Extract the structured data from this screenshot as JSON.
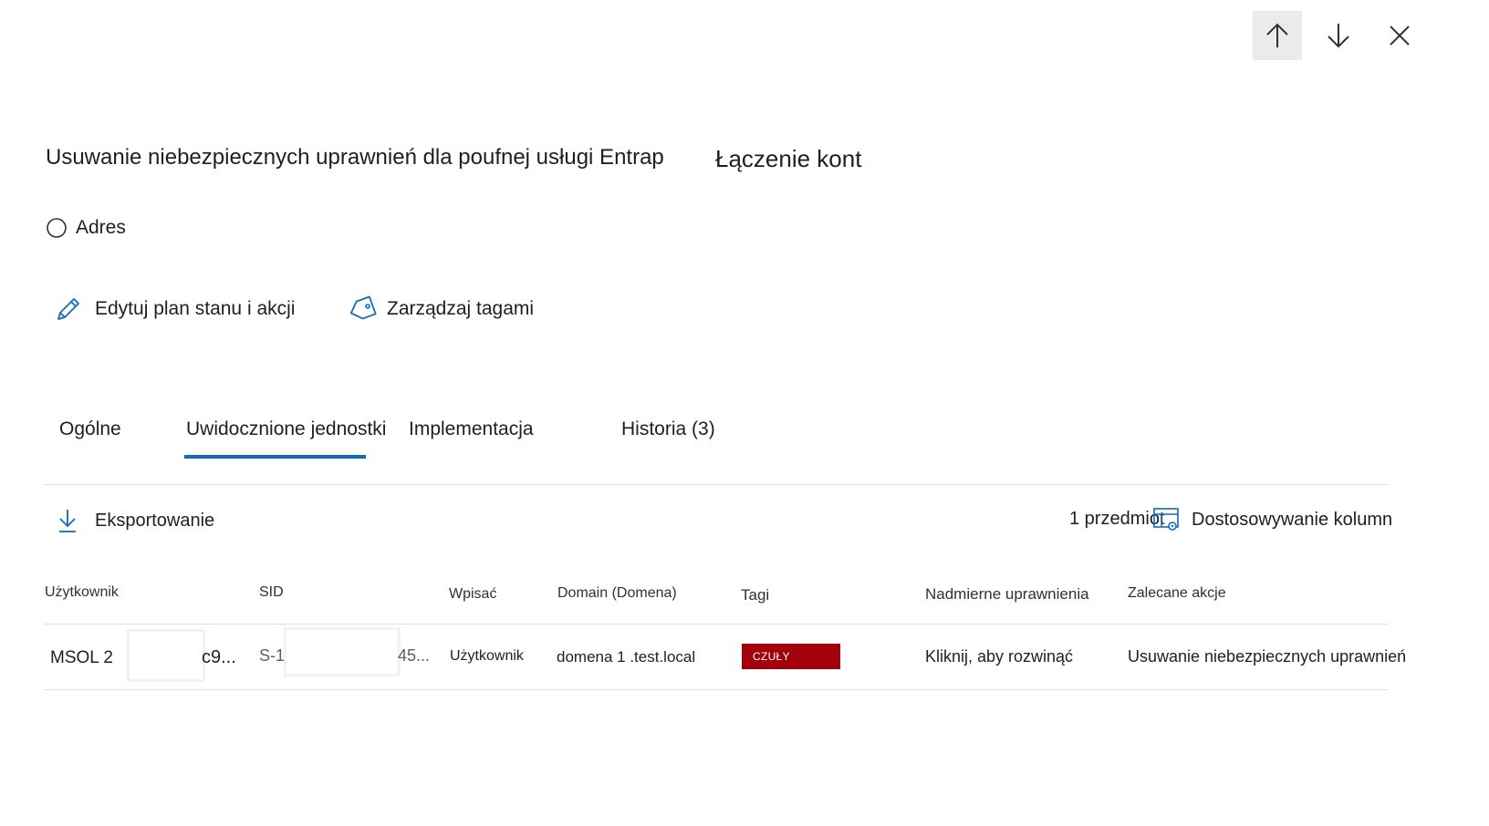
{
  "nav": {
    "up_icon": "arrow-up-icon",
    "down_icon": "arrow-down-icon",
    "close_icon": "close-icon"
  },
  "header": {
    "title": "Usuwanie niebezpiecznych uprawnień dla poufnej usługi Entrap",
    "subtitle": "Łączenie kont",
    "status_label": "Adres"
  },
  "actions": {
    "edit_label": "Edytuj plan stanu i akcji",
    "edit_icon": "pencil-icon",
    "tags_label": "Zarządzaj tagami",
    "tags_icon": "tag-icon"
  },
  "tabs": [
    {
      "label": "Ogólne",
      "selected": false
    },
    {
      "label": "Uwidocznione jednostki",
      "selected": true
    },
    {
      "label": "Implementacja",
      "selected": false
    },
    {
      "label": "Historia (3)",
      "selected": false
    }
  ],
  "toolbar": {
    "export_label": "Eksportowanie",
    "export_icon": "download-icon",
    "count_label": "1 przedmiot",
    "customize_label": "Dostosowywanie kolumn",
    "customize_icon": "table-settings-icon"
  },
  "table": {
    "columns": [
      "Użytkownik",
      "SID",
      "Wpisać",
      "Domain (Domena)",
      "Tagi",
      "Nadmierne uprawnienia",
      "Zalecane akcje"
    ],
    "rows": [
      {
        "user_prefix": "MSOL 2",
        "user_suffix": "c9...",
        "sid_prefix": "S-1",
        "sid_suffix": "45...",
        "type": "Użytkownik",
        "domain": "domena 1 .test.local",
        "tag": "CZUŁY",
        "excessive": "Kliknij, aby rozwinąć",
        "recommended": "Usuwanie niebezpiecznych uprawnień"
      }
    ]
  },
  "colors": {
    "accent": "#0f6cbd",
    "tag_bg": "#a4000b",
    "divider": "#e1dfdd",
    "hover_bg": "#edebe9"
  }
}
